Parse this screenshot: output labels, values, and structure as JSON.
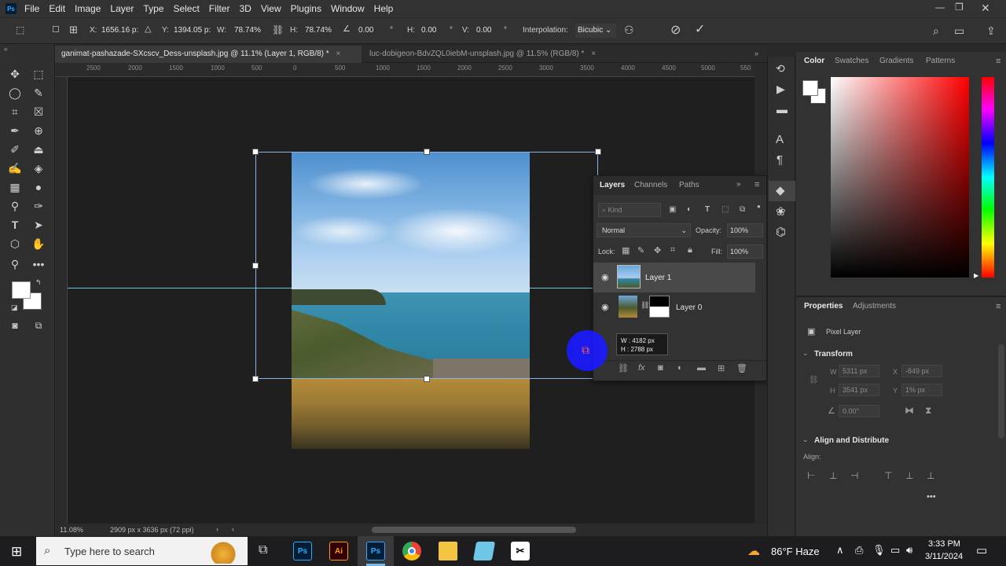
{
  "app": {
    "logo": "Ps"
  },
  "menu": [
    "File",
    "Edit",
    "Image",
    "Layer",
    "Type",
    "Select",
    "Filter",
    "3D",
    "View",
    "Plugins",
    "Window",
    "Help"
  ],
  "options": {
    "x_label": "X:",
    "x_value": "1656.16 p:",
    "y_label": "Y:",
    "y_value": "1394.05 p:",
    "w_label": "W:",
    "w_value": "78.74%",
    "h_label": "H:",
    "h_value": "78.74%",
    "angle_value": "0.00",
    "hskew_label": "H:",
    "hskew_value": "0.00",
    "vskew_label": "V:",
    "vskew_value": "0.00",
    "degree": "°",
    "interpolation_label": "Interpolation:",
    "interpolation_value": "Bicubic"
  },
  "tabs": [
    {
      "label": "ganimat-pashazade-SXcscv_Dess-unsplash.jpg @ 11.1% (Layer 1, RGB/8) *",
      "close": "×"
    },
    {
      "label": "luc-dobigeon-BdvZQL0iebM-unsplash.jpg @ 11.5% (RGB/8) *",
      "close": "×"
    }
  ],
  "ruler": [
    "2500",
    "2000",
    "1500",
    "1000",
    "500",
    "0",
    "500",
    "1000",
    "1500",
    "2000",
    "2500",
    "3000",
    "3500",
    "4000",
    "4500",
    "5000",
    "550"
  ],
  "transform_tooltip": {
    "w": "W :  4182 px",
    "h": "H :  2788 px"
  },
  "status": {
    "zoom": "11.08%",
    "doc": "2909 px x 3636 px (72 ppi)"
  },
  "layers_panel": {
    "tabs": [
      "Layers",
      "Channels",
      "Paths"
    ],
    "kind_placeholder": "Kind",
    "blend_mode": "Normal",
    "opacity_label": "Opacity:",
    "opacity_value": "100%",
    "lock_label": "Lock:",
    "fill_label": "Fill:",
    "fill_value": "100%",
    "layers": [
      {
        "name": "Layer 1",
        "selected": true
      },
      {
        "name": "Layer 0",
        "selected": false
      }
    ]
  },
  "color_panel": {
    "tabs": [
      "Color",
      "Swatches",
      "Gradients",
      "Patterns"
    ]
  },
  "properties_panel": {
    "tabs": [
      "Properties",
      "Adjustments"
    ],
    "type": "Pixel Layer",
    "transform_heading": "Transform",
    "w_label": "W",
    "w_value": "5311 px",
    "x_label": "X",
    "x_value": "-849 px",
    "h_label": "H",
    "h_value": "3541 px",
    "y_label": "Y",
    "y_value": "1% px",
    "angle_value": "0.00°",
    "align_heading": "Align and Distribute",
    "align_label": "Align:",
    "more": "•••"
  },
  "taskbar": {
    "search_placeholder": "Type here to search",
    "weather": "86°F  Haze",
    "time": "3:33 PM",
    "date": "3/11/2024",
    "apps": [
      "Ps",
      "Ai",
      "Ps"
    ]
  },
  "colors": {
    "accent_blue": "#1473e6",
    "cursor_circle": "#1a1aff",
    "guide": "#6fc3d6"
  }
}
